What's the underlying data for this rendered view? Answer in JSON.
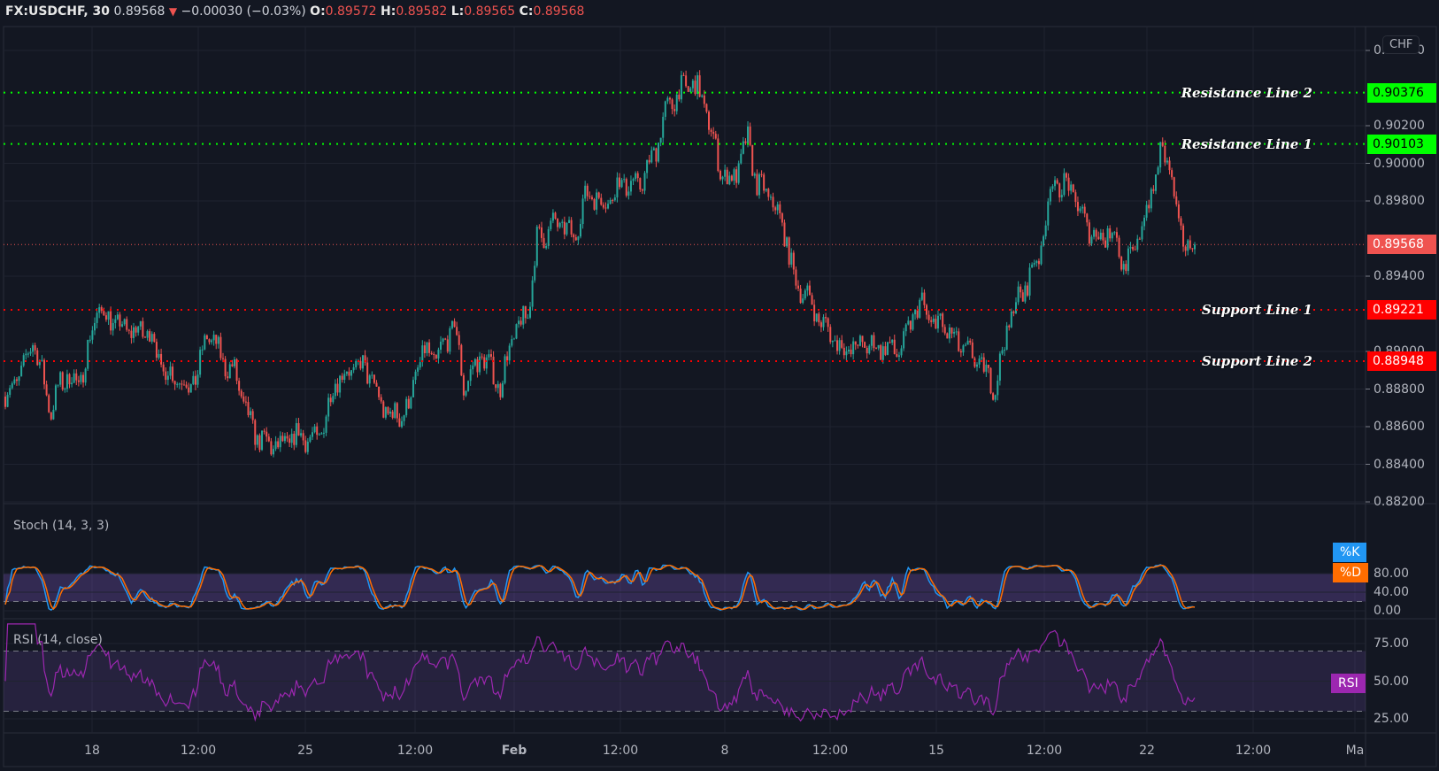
{
  "header": {
    "symbol": "FX:USDCHF, 30",
    "last": "0.89568",
    "change_icon": "triangle-down-icon",
    "change": "−0.00030 (−0.03%)",
    "o_label": "O:",
    "o": "0.89572",
    "h_label": "H:",
    "h": "0.89582",
    "l_label": "L:",
    "l": "0.89565",
    "c_label": "C:",
    "c": "0.89568"
  },
  "currency_button": "CHF",
  "colors": {
    "background": "#131722",
    "up": "#26a69a",
    "down": "#ef5350",
    "resistance": "#00ff00",
    "support": "#ff0000",
    "last_price": "#ef5350",
    "stoch_k": "#2196f3",
    "stoch_d": "#ff6d00",
    "rsi": "#9c27b0"
  },
  "chart_data": [
    {
      "type": "candlestick",
      "title": "FX:USDCHF, 30",
      "y_ticks": [
        "0.90600",
        "0.90200",
        "0.90000",
        "0.89800",
        "0.89400",
        "0.89000",
        "0.88800",
        "0.88600",
        "0.88400",
        "0.88200"
      ],
      "x_ticks": [
        "18",
        "12:00",
        "25",
        "12:00",
        "Feb",
        "12:00",
        "8",
        "12:00",
        "15",
        "12:00",
        "22",
        "12:00",
        "Ma"
      ],
      "ylim": [
        0.8819,
        0.907
      ],
      "grid": true,
      "close": [
        0.8876,
        0.8883,
        0.8891,
        0.8907,
        0.8888,
        0.8868,
        0.8883,
        0.8887,
        0.8881,
        0.8901,
        0.8922,
        0.8919,
        0.8915,
        0.8912,
        0.8911,
        0.891,
        0.891,
        0.8891,
        0.8888,
        0.8886,
        0.8881,
        0.8888,
        0.891,
        0.8902,
        0.8893,
        0.8889,
        0.8871,
        0.8858,
        0.8852,
        0.885,
        0.8849,
        0.8852,
        0.8856,
        0.8854,
        0.8852,
        0.8866,
        0.8886,
        0.8888,
        0.8891,
        0.8892,
        0.8885,
        0.8871,
        0.8866,
        0.8866,
        0.8871,
        0.8893,
        0.89,
        0.8895,
        0.8905,
        0.8915,
        0.8881,
        0.889,
        0.8898,
        0.889,
        0.8881,
        0.8902,
        0.8913,
        0.892,
        0.8959,
        0.8963,
        0.8968,
        0.8966,
        0.8959,
        0.8979,
        0.8985,
        0.8979,
        0.8981,
        0.899,
        0.8989,
        0.8988,
        0.8996,
        0.9009,
        0.9027,
        0.9035,
        0.904,
        0.9042,
        0.9035,
        0.9017,
        0.8997,
        0.899,
        0.8998,
        0.9013,
        0.8988,
        0.8985,
        0.8976,
        0.8964,
        0.8939,
        0.8932,
        0.8925,
        0.8915,
        0.891,
        0.8903,
        0.89,
        0.8903,
        0.8903,
        0.8903,
        0.8902,
        0.89,
        0.8903,
        0.892,
        0.8925,
        0.8915,
        0.8915,
        0.8909,
        0.8903,
        0.8899,
        0.8895,
        0.8888,
        0.8881,
        0.8905,
        0.8925,
        0.893,
        0.8944,
        0.8954,
        0.8988,
        0.8988,
        0.8988,
        0.8977,
        0.8967,
        0.8961,
        0.8962,
        0.8964,
        0.8945,
        0.895,
        0.8968,
        0.8983,
        0.9005,
        0.9,
        0.8963,
        0.8957,
        0.8957
      ],
      "levels": [
        {
          "name": "Resistance Line 2",
          "price": 0.90376,
          "label": "0.90376",
          "kind": "resistance"
        },
        {
          "name": "Resistance Line 1",
          "price": 0.90103,
          "label": "0.90103",
          "kind": "resistance"
        },
        {
          "name": "Support Line 1",
          "price": 0.89221,
          "label": "0.89221",
          "kind": "support"
        },
        {
          "name": "Support Line 2",
          "price": 0.88948,
          "label": "0.88948",
          "kind": "support"
        }
      ],
      "last_price": {
        "price": 0.89568,
        "label": "0.89568"
      }
    },
    {
      "type": "line",
      "title": "Stoch (14, 3, 3)",
      "series": [
        {
          "name": "%K"
        },
        {
          "name": "%D"
        }
      ],
      "bands": [
        20,
        80
      ],
      "y_ticks": [
        "80.00",
        "40.00",
        "0.00"
      ],
      "ylim": [
        0,
        100
      ]
    },
    {
      "type": "line",
      "title": "RSI (14, close)",
      "series": [
        {
          "name": "RSI"
        }
      ],
      "bands": [
        30,
        70
      ],
      "y_ticks": [
        "75.00",
        "50.00",
        "25.00"
      ],
      "ylim": [
        20,
        90
      ]
    }
  ]
}
